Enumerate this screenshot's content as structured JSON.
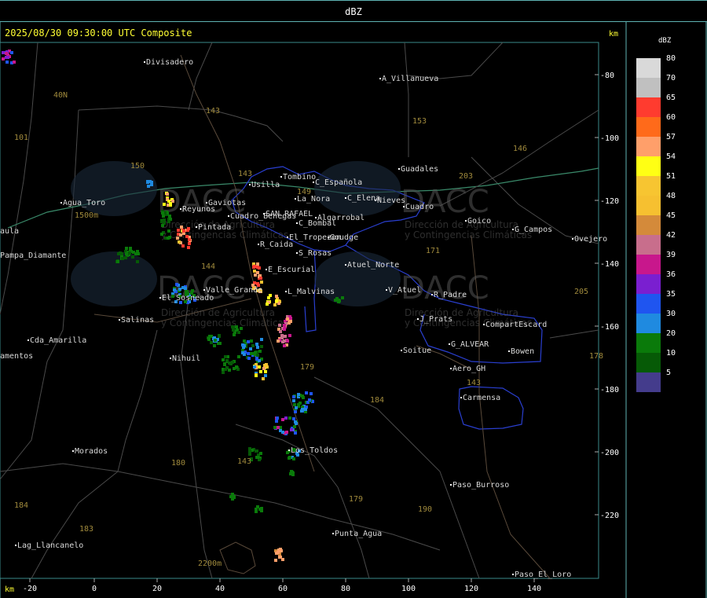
{
  "window": {
    "title": "dBZ"
  },
  "map": {
    "header": "2025/08/30 09:30:00 UTC Composite",
    "unit_top": "km",
    "unit_bottom": "km",
    "x_ticks": [
      "-20",
      "0",
      "20",
      "40",
      "60",
      "80",
      "100",
      "120",
      "140"
    ],
    "y_ticks": [
      "-80",
      "-100",
      "-120",
      "-140",
      "-160",
      "-180",
      "-200",
      "-220"
    ],
    "watermark": {
      "brand": "DACC",
      "line1": "Dirección de Agricultura",
      "line2": "y Contingencias Climáticas"
    },
    "places": [
      "Divisadero",
      "A_Villanueva",
      "Guadales",
      "Agua_Toro",
      "Tombino",
      "Usilla",
      "C_Española",
      "La_Nora",
      "C_Elena",
      "Nieves",
      "Cuadro_Benegas",
      "Gaviotas",
      "SAN_RAFAEL",
      "Algarrobal",
      "C_Bombal",
      "Pintada",
      "El_Tropezon",
      "Goudge",
      "Reyunos",
      "R_Caida",
      "S_Rosas",
      "Atuel_Norte",
      "E_Escurial",
      "El_Sosneado",
      "Valle_Grande",
      "L_Malvinas",
      "V_Atuel",
      "R_Padre",
      "Salinas",
      "Cda_Amarilla",
      "Nihuil",
      "J_Prats",
      "CompartEscard",
      "G_ALVEAR",
      "Bowen",
      "Soitue",
      "Aero_GH",
      "Carmensa",
      "Morados",
      "Los_Toldos",
      "Paso_Burroso",
      "Punta_Agua",
      "Lag_Llancanelo",
      "Paso_El_Loro",
      "Goico",
      "G_Campos",
      "Ovejero",
      "Pampa_Diamante",
      "aula",
      "amentos",
      "Cuadro"
    ],
    "roads": [
      "40N",
      "101",
      "150",
      "143",
      "153",
      "146",
      "203",
      "171",
      "144",
      "143",
      "149",
      "179",
      "184",
      "180",
      "179",
      "190",
      "183",
      "184",
      "143",
      "143",
      "205",
      "178"
    ],
    "elevations": [
      "1500m",
      "2200m"
    ]
  },
  "legend": {
    "title": "dBZ",
    "levels": [
      {
        "value": "80",
        "color": "#d9d9d9"
      },
      {
        "value": "70",
        "color": "#c0c0c0"
      },
      {
        "value": "65",
        "color": "#ff3b2f"
      },
      {
        "value": "60",
        "color": "#ff6a1a"
      },
      {
        "value": "57",
        "color": "#ff9f6a"
      },
      {
        "value": "54",
        "color": "#ffff14"
      },
      {
        "value": "51",
        "color": "#f7c531"
      },
      {
        "value": "48",
        "color": "#f6c030"
      },
      {
        "value": "45",
        "color": "#d48a3a"
      },
      {
        "value": "42",
        "color": "#c86e8c"
      },
      {
        "value": "39",
        "color": "#c8178c"
      },
      {
        "value": "36",
        "color": "#7a1fd0"
      },
      {
        "value": "35",
        "color": "#1f55f0"
      },
      {
        "value": "30",
        "color": "#1f8ae0"
      },
      {
        "value": "20",
        "color": "#0a7a0a"
      },
      {
        "value": "10",
        "color": "#065a06"
      },
      {
        "value": "5",
        "color": "#443c8c"
      }
    ]
  }
}
